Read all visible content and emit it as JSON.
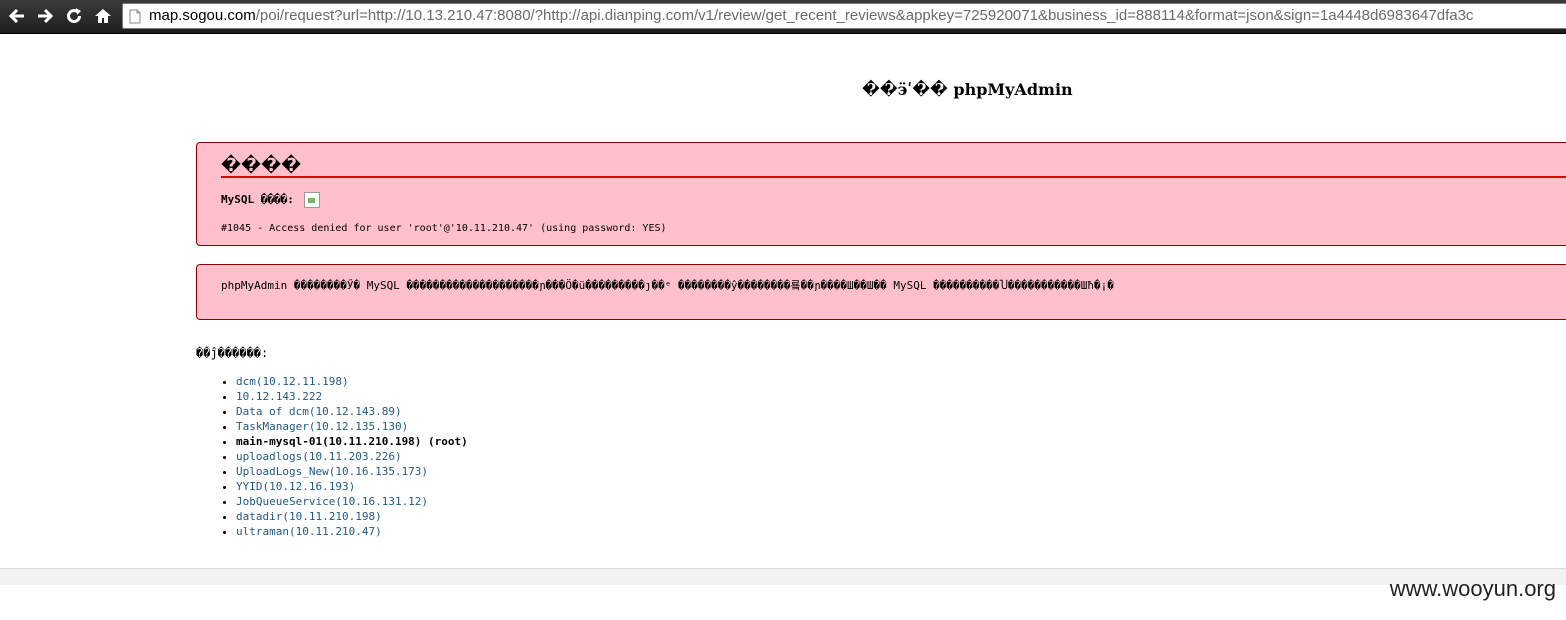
{
  "browser": {
    "url_host": "map.sogou.com",
    "url_path": "/poi/request?url=http://10.13.210.47:8080/?http://api.dianping.com/v1/review/get_recent_reviews&appkey=725920071&business_id=888114&format=json&sign=1a4448d6983647dfa3c",
    "icons": [
      "back-arrow-icon",
      "forward-arrow-icon",
      "reload-icon",
      "home-icon",
      "page-icon"
    ]
  },
  "page": {
    "title": "��ӭʹ�� phpMyAdmin"
  },
  "error_box": {
    "title": "����",
    "mysql_label": "MySQL ����:",
    "message": "#1045 - Access denied for user 'root'@'10.11.210.47' (using password: YES)"
  },
  "notice_box": {
    "text": "phpMyAdmin ��������Ӳ� MySQL ��������������������ɲ���Ö�ü���������ȷ��ᵉ ��������ŷ��������룤��ɲ����Ш��Ш�� MySQL ����������Ⴎ�����������Шħ�¡�"
  },
  "servers": {
    "heading": "��ĵ������:",
    "items": [
      {
        "label": "dcm(10.12.11.198)",
        "current": false
      },
      {
        "label": "10.12.143.222",
        "current": false
      },
      {
        "label": "Data of dcm(10.12.143.89)",
        "current": false
      },
      {
        "label": "TaskManager(10.12.135.130)",
        "current": false
      },
      {
        "label": "main-mysql-01(10.11.210.198) (root)",
        "current": true
      },
      {
        "label": "uploadlogs(10.11.203.226)",
        "current": false
      },
      {
        "label": "UploadLogs_New(10.16.135.173)",
        "current": false
      },
      {
        "label": "YYID(10.12.16.193)",
        "current": false
      },
      {
        "label": "JobQueueService(10.16.131.12)",
        "current": false
      },
      {
        "label": "datadir(10.11.210.198)",
        "current": false
      },
      {
        "label": "ultraman(10.11.210.47)",
        "current": false
      }
    ]
  },
  "watermark": "www.wooyun.org"
}
